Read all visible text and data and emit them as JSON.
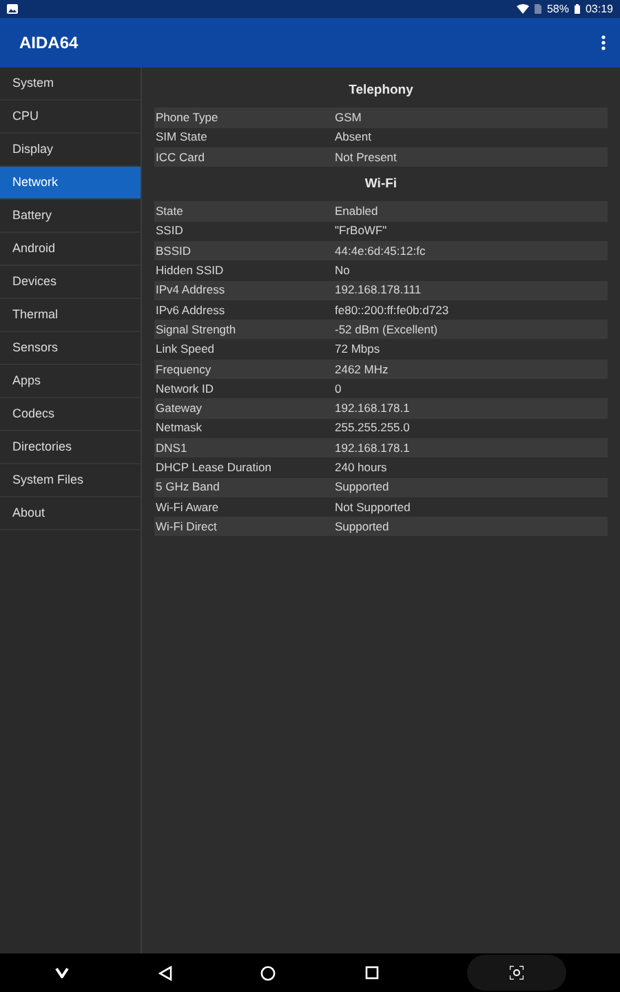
{
  "status_bar": {
    "battery": "58%",
    "time": "03:19"
  },
  "app_bar": {
    "title": "AIDA64"
  },
  "sidebar": {
    "items": [
      {
        "label": "System",
        "selected": false
      },
      {
        "label": "CPU",
        "selected": false
      },
      {
        "label": "Display",
        "selected": false
      },
      {
        "label": "Network",
        "selected": true
      },
      {
        "label": "Battery",
        "selected": false
      },
      {
        "label": "Android",
        "selected": false
      },
      {
        "label": "Devices",
        "selected": false
      },
      {
        "label": "Thermal",
        "selected": false
      },
      {
        "label": "Sensors",
        "selected": false
      },
      {
        "label": "Apps",
        "selected": false
      },
      {
        "label": "Codecs",
        "selected": false
      },
      {
        "label": "Directories",
        "selected": false
      },
      {
        "label": "System Files",
        "selected": false
      },
      {
        "label": "About",
        "selected": false
      }
    ]
  },
  "sections": [
    {
      "title": "Telephony",
      "rows": [
        {
          "label": "Phone Type",
          "value": "GSM"
        },
        {
          "label": "SIM State",
          "value": "Absent"
        },
        {
          "label": "ICC Card",
          "value": "Not Present"
        }
      ]
    },
    {
      "title": "Wi-Fi",
      "rows": [
        {
          "label": "State",
          "value": "Enabled"
        },
        {
          "label": "SSID",
          "value": "\"FrBoWF\""
        },
        {
          "label": "BSSID",
          "value": "44:4e:6d:45:12:fc"
        },
        {
          "label": "Hidden SSID",
          "value": "No"
        },
        {
          "label": "IPv4 Address",
          "value": "192.168.178.111"
        },
        {
          "label": "IPv6 Address",
          "value": "fe80::200:ff:fe0b:d723"
        },
        {
          "label": "Signal Strength",
          "value": "-52 dBm (Excellent)"
        },
        {
          "label": "Link Speed",
          "value": "72 Mbps"
        },
        {
          "label": "Frequency",
          "value": "2462 MHz"
        },
        {
          "label": "Network ID",
          "value": "0"
        },
        {
          "label": "Gateway",
          "value": "192.168.178.1"
        },
        {
          "label": "Netmask",
          "value": "255.255.255.0"
        },
        {
          "label": "DNS1",
          "value": "192.168.178.1"
        },
        {
          "label": "DHCP Lease Duration",
          "value": "240 hours"
        },
        {
          "label": "5 GHz Band",
          "value": "Supported"
        },
        {
          "label": "Wi-Fi Aware",
          "value": "Not Supported"
        },
        {
          "label": "Wi-Fi Direct",
          "value": "Supported"
        }
      ]
    }
  ]
}
